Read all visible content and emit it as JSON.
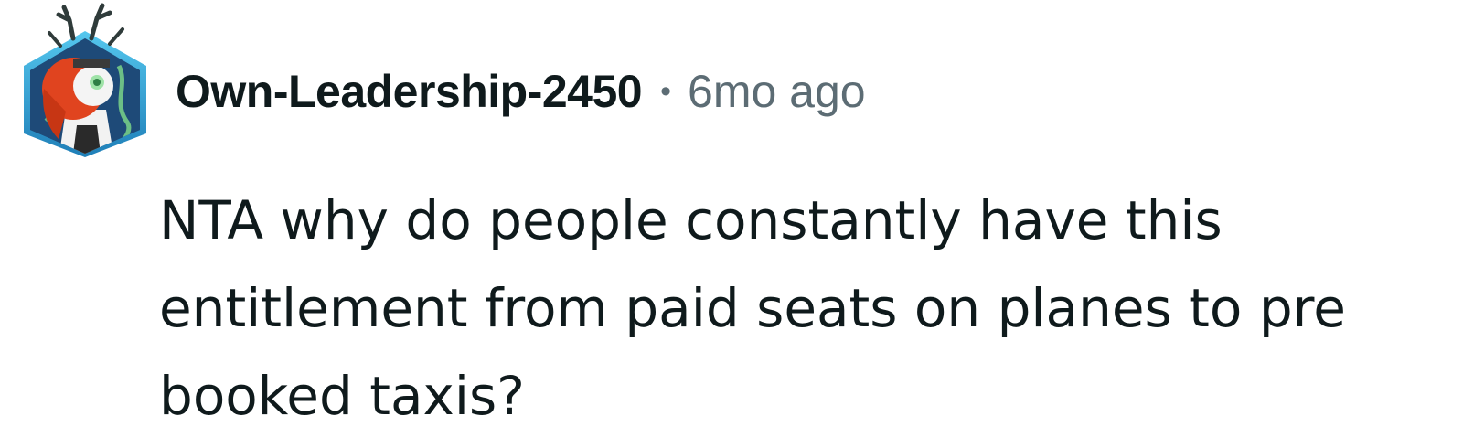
{
  "comment": {
    "avatar_icon": "user-avatar-robot-hexagon-icon",
    "author": "Own-Leadership-2450",
    "separator": "•",
    "timestamp": "6mo ago",
    "body_lines": [
      "NTA why do people constantly have this",
      "entitlement from paid seats on planes to pre",
      "booked taxis?"
    ]
  },
  "colors": {
    "author": "#0f1a1c",
    "meta": "#5c6c74",
    "body": "#0f1a1c",
    "avatar_frame": "#2b8fc9",
    "avatar_hair": "#e0441f"
  }
}
